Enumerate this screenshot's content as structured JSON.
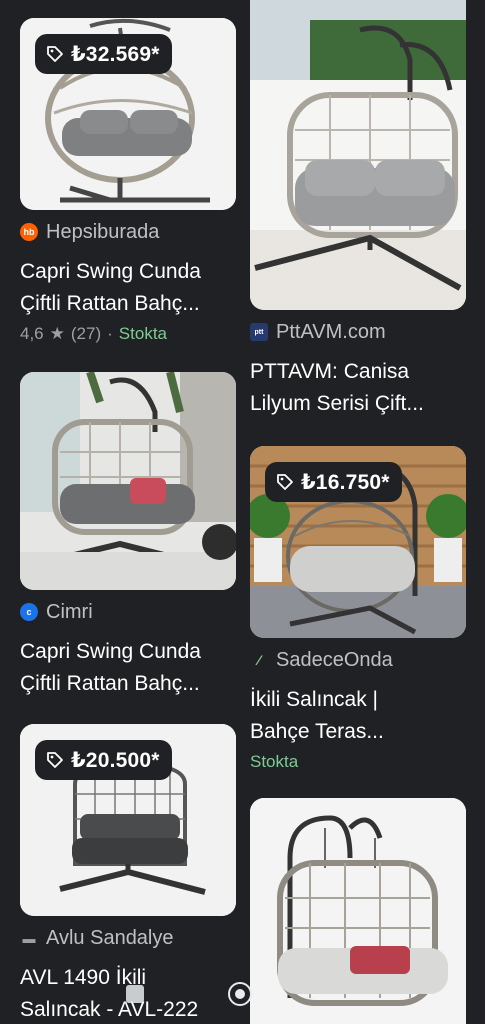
{
  "cards": [
    {
      "price": "₺32.569*",
      "source": "Hepsiburada",
      "source_icon": "hepsiburada-icon",
      "title1": "Capri Swing Cunda",
      "title2": "Çiftli Rattan Bahç...",
      "rating": "4,6",
      "reviews": "(27)",
      "stock": "Stokta"
    },
    {
      "source": "PttAVM.com",
      "source_icon": "pttavm-icon",
      "title1": "PTTAVM: Canisa",
      "title2": "Lilyum Serisi Çift..."
    },
    {
      "source": "Cimri",
      "source_icon": "cimri-icon",
      "title1": "Capri Swing Cunda",
      "title2": "Çiftli Rattan Bahç..."
    },
    {
      "price": "₺16.750*",
      "source": "SadeceOnda",
      "source_icon": "sadeceonda-icon",
      "title1": "İkili Salıncak |",
      "title2": "Bahçe Teras...",
      "stock": "Stokta"
    },
    {
      "price": "₺20.500*",
      "source": "Avlu Sandalye",
      "source_icon": "avlu-sandalye-icon",
      "title1": "AVL 1490 İkili",
      "title2": "Salıncak - AVL-222"
    },
    {}
  ],
  "colors": {
    "background": "#202124",
    "stock_green": "#81c995",
    "hepsiburada_orange": "#ff6000",
    "cimri_blue": "#1a73e8"
  }
}
